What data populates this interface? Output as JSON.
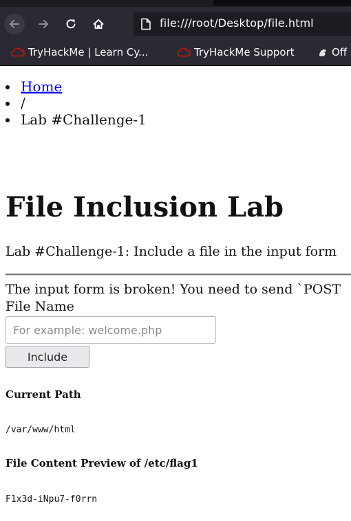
{
  "browser": {
    "url": "file:///root/Desktop/file.html",
    "bookmarks": [
      {
        "label": "TryHackMe | Learn Cy..."
      },
      {
        "label": "TryHackMe Support"
      },
      {
        "label": "Off"
      }
    ]
  },
  "page": {
    "breadcrumb": {
      "home": "Home",
      "separator": "/",
      "current": "Lab #Challenge-1"
    },
    "title": "File Inclusion Lab",
    "description": "Lab #Challenge-1: Include a file in the input form",
    "warning": "The input form is broken! You need to send `POST",
    "form": {
      "label": "File Name",
      "placeholder": "For example: welcome.php",
      "value": "",
      "button": "Include"
    },
    "current_path": {
      "heading": "Current Path",
      "value": "/var/www/html"
    },
    "preview": {
      "heading": "File Content Preview of /etc/flag1",
      "value": "F1x3d-iNpu7-f0rrn"
    }
  }
}
